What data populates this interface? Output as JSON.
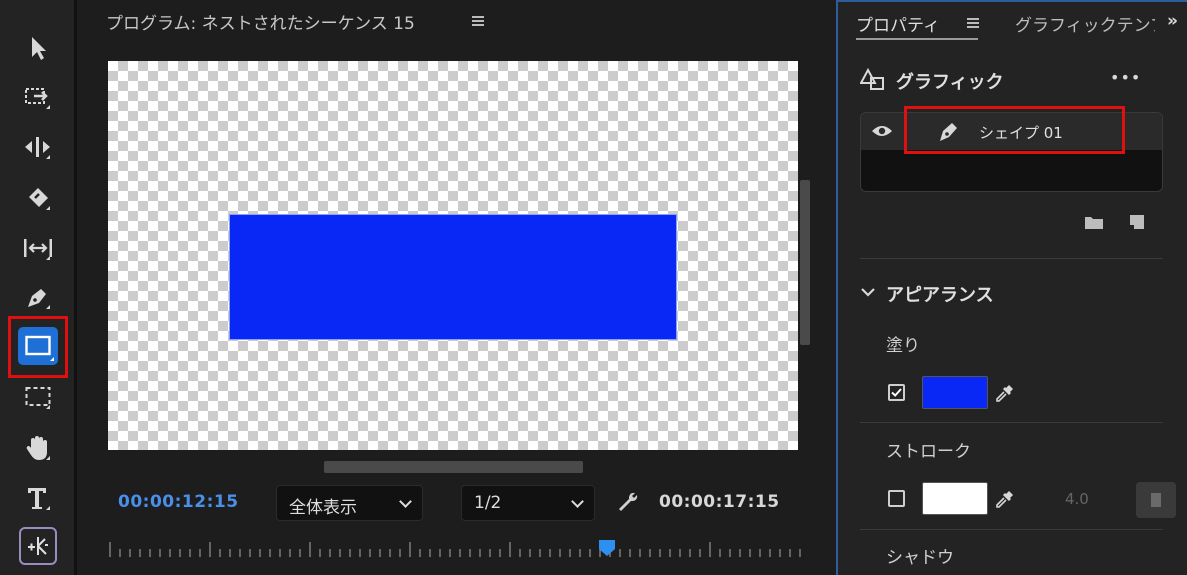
{
  "program_monitor": {
    "title": "プログラム: ネストされたシーケンス 15",
    "current_timecode": "00:00:12:15",
    "duration_timecode": "00:00:17:15",
    "zoom_level": "全体表示",
    "resolution": "1/2",
    "shape_color": "#0a28f5",
    "playhead_position": 0.71
  },
  "properties_panel": {
    "tab_properties": "プロパティ",
    "tab_graphics": "グラフィックテンプレート",
    "more_tabs": "»",
    "graphics_title": "グラフィック",
    "more_menu": "•••",
    "layer_name": "シェイプ 01",
    "appearance_title": "アピアランス",
    "fill_label": "塗り",
    "fill_checked": true,
    "fill_color": "#0a28f5",
    "stroke_label": "ストローク",
    "stroke_checked": false,
    "stroke_color": "#ffffff",
    "stroke_width": "4.0",
    "shadow_label": "シャドウ"
  },
  "tools": [
    {
      "name": "selection-tool-icon",
      "selected": false
    },
    {
      "name": "track-select-tool-icon",
      "selected": false
    },
    {
      "name": "ripple-edit-tool-icon",
      "selected": false
    },
    {
      "name": "razor-tool-icon",
      "selected": false
    },
    {
      "name": "slip-tool-icon",
      "selected": false
    },
    {
      "name": "pen-tool-icon",
      "selected": false
    },
    {
      "name": "rectangle-tool-icon",
      "selected": true
    },
    {
      "name": "marquee-tool-icon",
      "selected": false
    },
    {
      "name": "hand-tool-icon",
      "selected": false
    },
    {
      "name": "type-tool-icon",
      "selected": false
    },
    {
      "name": "generative-tool-icon",
      "selected": false
    }
  ]
}
